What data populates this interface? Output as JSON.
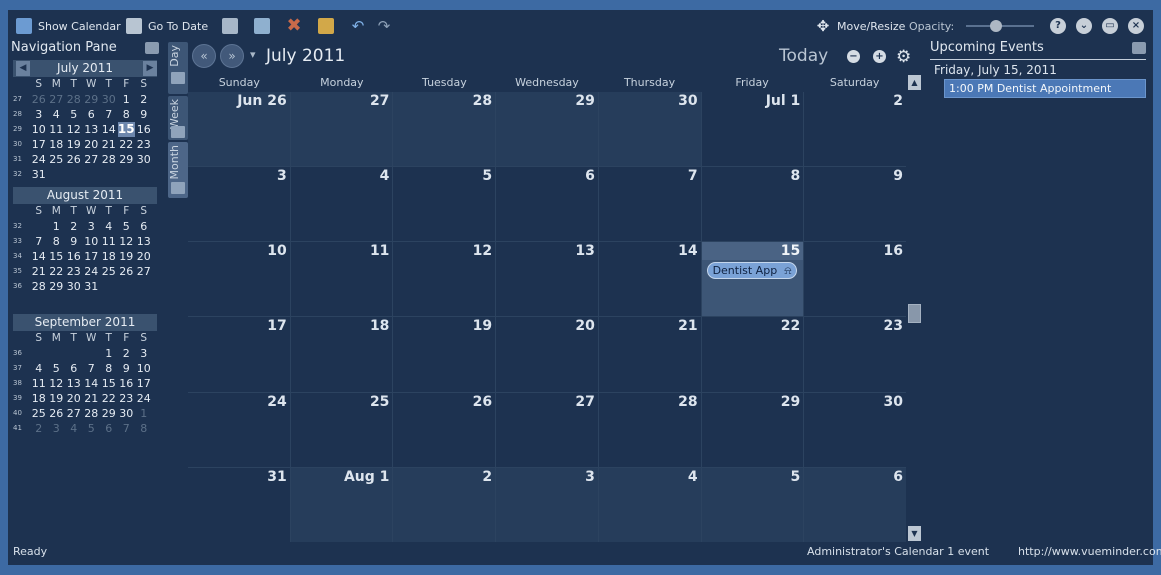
{
  "toolbar": {
    "show_calendar": "Show Calendar",
    "go_to_date": "Go To Date",
    "move_resize": "Move/Resize",
    "opacity": "Opacity:",
    "help": "?",
    "minimize": "⌄",
    "restore": "▭",
    "close": "×"
  },
  "nav_pane": {
    "title": "Navigation Pane",
    "months": [
      {
        "title": "July 2011",
        "dow": [
          "S",
          "M",
          "T",
          "W",
          "T",
          "F",
          "S"
        ],
        "weeks": [
          {
            "wk": "27",
            "days": [
              "26",
              "27",
              "28",
              "29",
              "30",
              "1",
              "2"
            ]
          },
          {
            "wk": "28",
            "days": [
              "3",
              "4",
              "5",
              "6",
              "7",
              "8",
              "9"
            ]
          },
          {
            "wk": "29",
            "days": [
              "10",
              "11",
              "12",
              "13",
              "14",
              "15",
              "16"
            ]
          },
          {
            "wk": "30",
            "days": [
              "17",
              "18",
              "19",
              "20",
              "21",
              "22",
              "23"
            ]
          },
          {
            "wk": "31",
            "days": [
              "24",
              "25",
              "26",
              "27",
              "28",
              "29",
              "30"
            ]
          },
          {
            "wk": "32",
            "days": [
              "31",
              "",
              "",
              "",
              "",
              "",
              ""
            ]
          }
        ]
      },
      {
        "title": "August 2011",
        "dow": [
          "S",
          "M",
          "T",
          "W",
          "T",
          "F",
          "S"
        ],
        "weeks": [
          {
            "wk": "32",
            "days": [
              "",
              "1",
              "2",
              "3",
              "4",
              "5",
              "6"
            ]
          },
          {
            "wk": "33",
            "days": [
              "7",
              "8",
              "9",
              "10",
              "11",
              "12",
              "13"
            ]
          },
          {
            "wk": "34",
            "days": [
              "14",
              "15",
              "16",
              "17",
              "18",
              "19",
              "20"
            ]
          },
          {
            "wk": "35",
            "days": [
              "21",
              "22",
              "23",
              "24",
              "25",
              "26",
              "27"
            ]
          },
          {
            "wk": "36",
            "days": [
              "28",
              "29",
              "30",
              "31",
              "",
              "",
              ""
            ]
          }
        ]
      },
      {
        "title": "September 2011",
        "dow": [
          "S",
          "M",
          "T",
          "W",
          "T",
          "F",
          "S"
        ],
        "weeks": [
          {
            "wk": "36",
            "days": [
              "",
              "",
              "",
              "",
              "1",
              "2",
              "3"
            ]
          },
          {
            "wk": "37",
            "days": [
              "4",
              "5",
              "6",
              "7",
              "8",
              "9",
              "10"
            ]
          },
          {
            "wk": "38",
            "days": [
              "11",
              "12",
              "13",
              "14",
              "15",
              "16",
              "17"
            ]
          },
          {
            "wk": "39",
            "days": [
              "18",
              "19",
              "20",
              "21",
              "22",
              "23",
              "24"
            ]
          },
          {
            "wk": "40",
            "days": [
              "25",
              "26",
              "27",
              "28",
              "29",
              "30",
              "1"
            ]
          },
          {
            "wk": "41",
            "days": [
              "2",
              "3",
              "4",
              "5",
              "6",
              "7",
              "8"
            ]
          }
        ]
      }
    ]
  },
  "view_tabs": [
    "Day",
    "Week",
    "Month"
  ],
  "main": {
    "prev": "«",
    "next": "»",
    "dropdown": "▾",
    "title": "July 2011",
    "today": "Today",
    "zoom_out": "−",
    "zoom_in": "+",
    "settings": "⚙",
    "dow": [
      "Sunday",
      "Monday",
      "Tuesday",
      "Wednesday",
      "Thursday",
      "Friday",
      "Saturday"
    ],
    "weeks": [
      [
        "Jun 26",
        "27",
        "28",
        "29",
        "30",
        "Jul 1",
        "2"
      ],
      [
        "3",
        "4",
        "5",
        "6",
        "7",
        "8",
        "9"
      ],
      [
        "10",
        "11",
        "12",
        "13",
        "14",
        "15",
        "16"
      ],
      [
        "17",
        "18",
        "19",
        "20",
        "21",
        "22",
        "23"
      ],
      [
        "24",
        "25",
        "26",
        "27",
        "28",
        "29",
        "30"
      ],
      [
        "31",
        "Aug 1",
        "2",
        "3",
        "4",
        "5",
        "6"
      ]
    ],
    "event_pill": "Dentist App",
    "event_bell": "🔔"
  },
  "upcoming": {
    "title": "Upcoming Events",
    "date": "Friday, July 15, 2011",
    "event": "1:00 PM  Dentist Appointment"
  },
  "status": {
    "left": "Ready",
    "calendar": "Administrator's Calendar  1 event",
    "url": "http://www.vueminder.com"
  }
}
